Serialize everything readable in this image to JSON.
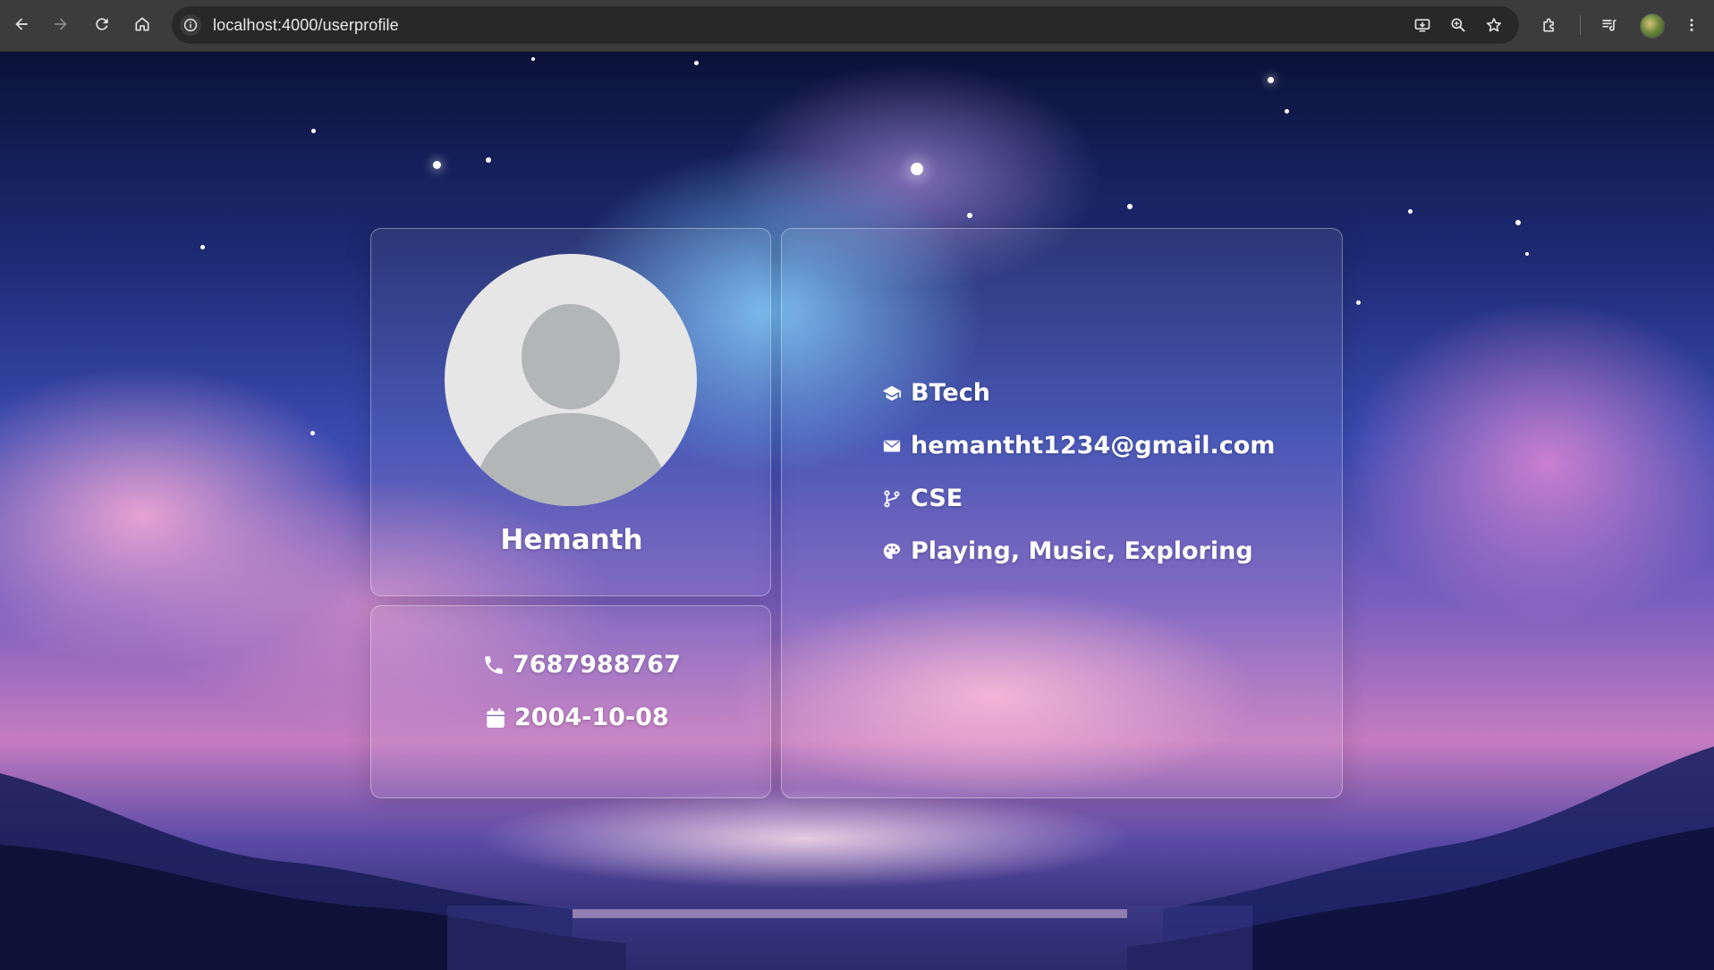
{
  "browser": {
    "url": "localhost:4000/userprofile",
    "icons": {
      "back": "arrow-left-icon",
      "forward": "arrow-right-icon",
      "reload": "reload-icon",
      "home": "home-icon",
      "site_info": "info-icon",
      "install": "install-app-icon",
      "zoom": "zoom-icon",
      "bookmark": "star-icon",
      "extensions": "puzzle-icon",
      "media": "media-controls-icon",
      "profile": "avatar",
      "menu": "kebab-menu-icon"
    }
  },
  "profile": {
    "name": "Hemanth",
    "avatar": "default-user-avatar"
  },
  "contact": {
    "phone": "7687988767",
    "dob": "2004-10-08"
  },
  "details": {
    "degree": "BTech",
    "email": "hemantht1234@gmail.com",
    "branch": "CSE",
    "hobbies": "Playing, Music, Exploring"
  },
  "colors": {
    "chrome_bg": "#3c3c3c",
    "omnibox_bg": "#282828",
    "text_light": "#ffffff",
    "avatar_bg": "#e6e6e6",
    "avatar_fg": "#b3b6b7"
  }
}
